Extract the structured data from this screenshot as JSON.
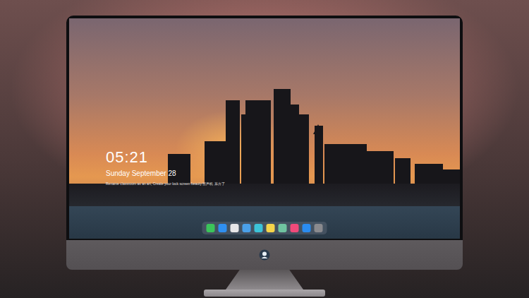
{
  "lock_screen": {
    "time": "05:21",
    "date": "Sunday September 28",
    "caption": "Rename classroom as an art, Create your lock screen beauty 留声机 东方了"
  },
  "dock": {
    "items": [
      {
        "color": "#3bc45a"
      },
      {
        "color": "#2f8ff0"
      },
      {
        "color": "#e6e6e8"
      },
      {
        "color": "#4aa0e8"
      },
      {
        "color": "#3cc3d8"
      },
      {
        "color": "#f5d44a"
      },
      {
        "color": "#6fc3a0"
      },
      {
        "color": "#f04a7a"
      },
      {
        "color": "#2a8cf0"
      },
      {
        "color": "#8a8a8e"
      }
    ]
  }
}
